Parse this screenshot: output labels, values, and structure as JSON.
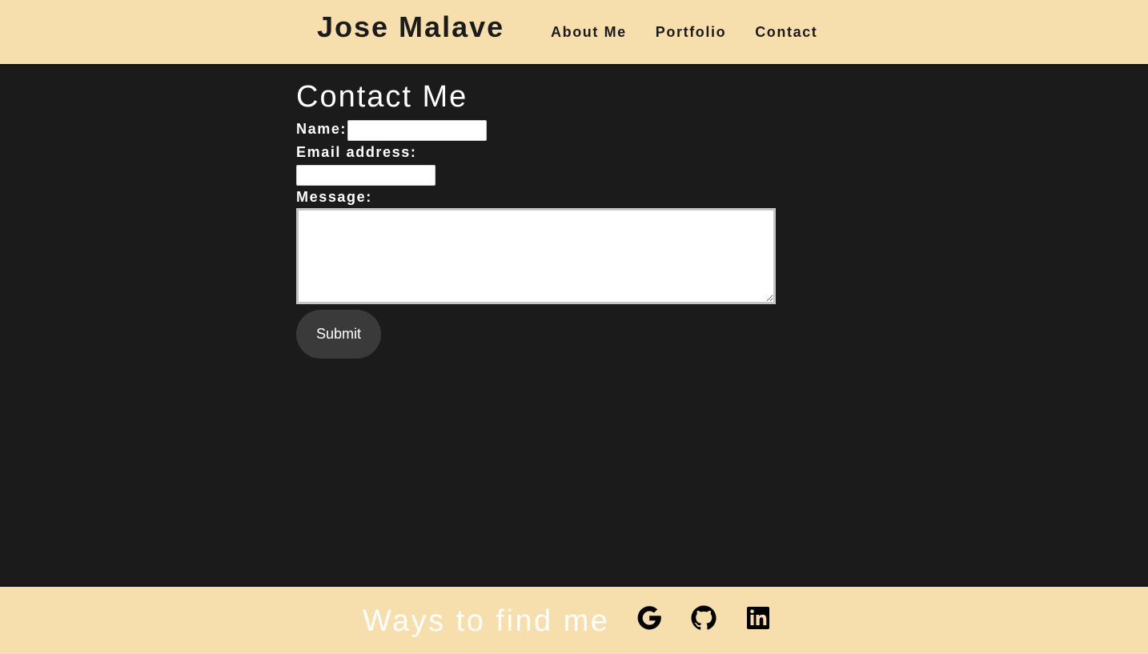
{
  "header": {
    "brand": "Jose Malave",
    "nav": [
      {
        "label": "About Me"
      },
      {
        "label": "Portfolio"
      },
      {
        "label": "Contact"
      }
    ]
  },
  "contact": {
    "title": "Contact Me",
    "name_label": "Name:",
    "name_value": "",
    "email_label": "Email address:",
    "email_value": "",
    "message_label": "Message:",
    "message_value": "",
    "submit_label": "Submit"
  },
  "footer": {
    "text": "Ways to find me",
    "links": [
      {
        "icon": "google-icon"
      },
      {
        "icon": "github-icon"
      },
      {
        "icon": "linkedin-icon"
      }
    ]
  },
  "colors": {
    "header_bg": "#f6dfac",
    "page_bg": "#1c1b1b",
    "button_bg": "#3b3a3a"
  }
}
